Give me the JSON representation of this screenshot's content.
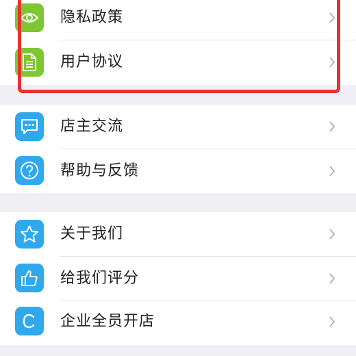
{
  "settings_menu": {
    "groups": [
      {
        "items": [
          {
            "label": "隐私政策",
            "icon": "eye-icon",
            "icon_color": "#7dc832"
          },
          {
            "label": "用户协议",
            "icon": "document-icon",
            "icon_color": "#7dc832"
          }
        ]
      },
      {
        "items": [
          {
            "label": "店主交流",
            "icon": "chat-bubble-icon",
            "icon_color": "#2fa8ee"
          },
          {
            "label": "帮助与反馈",
            "icon": "help-circle-icon",
            "icon_color": "#2fa8ee"
          }
        ]
      },
      {
        "items": [
          {
            "label": "关于我们",
            "icon": "star-icon",
            "icon_color": "#2fa8ee"
          },
          {
            "label": "给我们评分",
            "icon": "thumbs-up-icon",
            "icon_color": "#2fa8ee"
          },
          {
            "label": "企业全员开店",
            "icon": "c-letter-icon",
            "icon_color": "#2fa8ee"
          }
        ]
      }
    ]
  },
  "annotation": {
    "highlight_color": "#e8302f"
  }
}
